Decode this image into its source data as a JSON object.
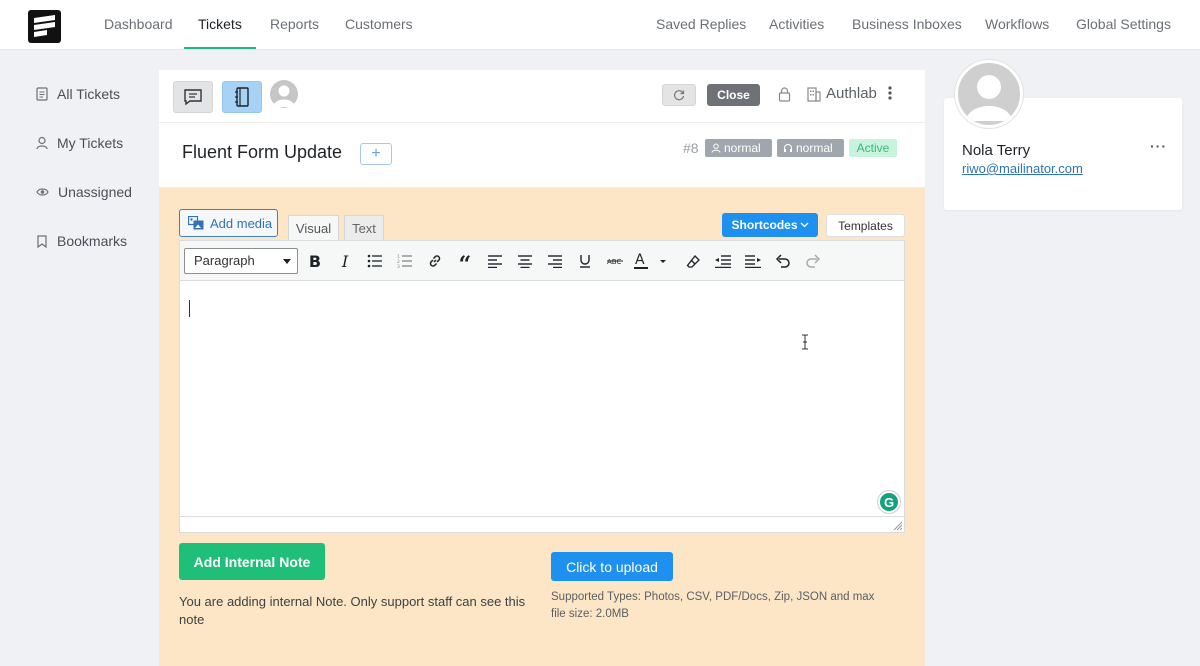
{
  "nav": {
    "left": [
      "Dashboard",
      "Tickets",
      "Reports",
      "Customers"
    ],
    "right": [
      "Saved Replies",
      "Activities",
      "Business Inboxes",
      "Workflows",
      "Global Settings"
    ],
    "active": "Tickets"
  },
  "sidebar": {
    "items": [
      {
        "label": "All Tickets",
        "icon": "document-icon"
      },
      {
        "label": "My Tickets",
        "icon": "user-icon"
      },
      {
        "label": "Unassigned",
        "icon": "eye-icon"
      },
      {
        "label": "Bookmarks",
        "icon": "bookmark-icon"
      }
    ]
  },
  "ticket": {
    "close_label": "Close",
    "company": "Authlab",
    "title": "Fluent Form Update",
    "add_tag": "+",
    "id": "#8",
    "priority": "normal",
    "agent_priority": "normal",
    "status": "Active"
  },
  "editor": {
    "add_media": "Add media",
    "tab_visual": "Visual",
    "tab_text": "Text",
    "shortcodes": "Shortcodes",
    "templates": "Templates",
    "format": "Paragraph",
    "grammarly": "G"
  },
  "actions": {
    "note_button": "Add Internal Note",
    "note_text": "You are adding internal Note. Only support staff can see this note",
    "upload_button": "Click to upload",
    "upload_text": "Supported Types: Photos, CSV, PDF/Docs, Zip, JSON and max file size: 2.0MB"
  },
  "customer": {
    "name": "Nola Terry",
    "email": "riwo@mailinator.com",
    "more": "···"
  },
  "colors": {
    "accent_green": "#20b885",
    "primary_blue": "#1e90f0",
    "reply_bg": "#fde6c5"
  }
}
